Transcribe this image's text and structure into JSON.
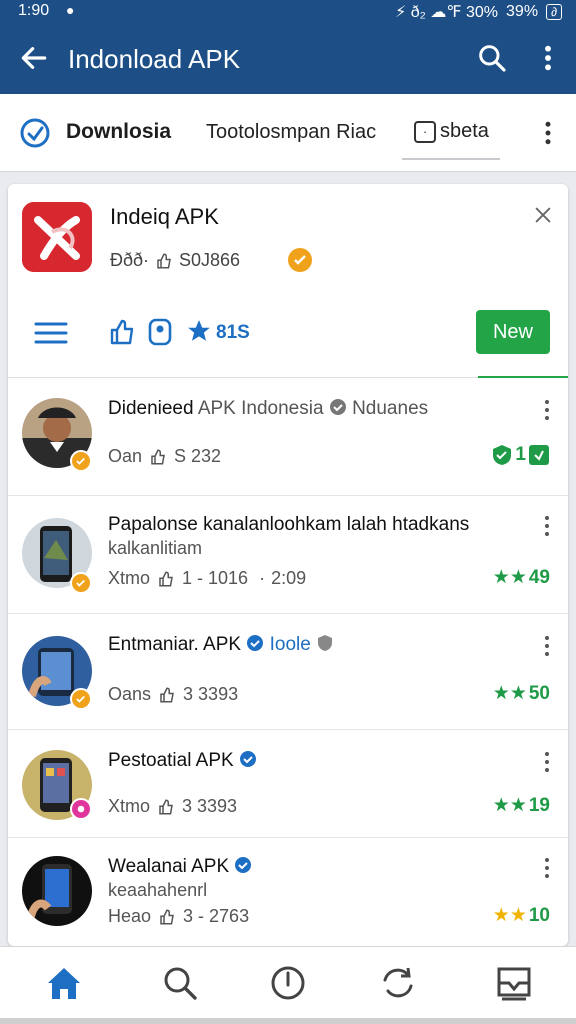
{
  "status_bar": {
    "time": "1:90",
    "indicators": "⚡ ð₂ ☁℉ 30%",
    "battery": "39%",
    "battery_box": "∂"
  },
  "app_bar": {
    "title": "Indonload APK",
    "icons": [
      "back-arrow-icon",
      "search-icon",
      "more-vertical-icon"
    ]
  },
  "tabs": [
    {
      "label": "Downlosia",
      "icon": "download-badge-icon"
    },
    {
      "label": "Tootolosmpan Riac"
    },
    {
      "label": "sbeta",
      "icon": "clock-box-icon"
    }
  ],
  "featured": {
    "title": "Indeiq APK",
    "meta_prefix": "Ððð·",
    "meta_count": "S0J866",
    "rating": "81S",
    "new_label": "New"
  },
  "list": [
    {
      "title": "Didenieed",
      "title_suffix": "APK Indonesia",
      "tag": "Nduanes",
      "meta_left": "Oan",
      "meta_right": "S 232",
      "rating": "1",
      "rating_color": "#1f9a46",
      "badge_color": "#f0a21a"
    },
    {
      "title": "Papalonse kanalanloohkam lalah htadkans",
      "line2": "kalkanlitiam",
      "meta_left": "Xtmo",
      "meta_right": "1 - 1016",
      "meta_extra": "2:09",
      "rating": "49",
      "rating_color": "#1f9a46",
      "badge_color": "#f0a21a"
    },
    {
      "title": "Entmaniar. APK",
      "tag": "Ioole",
      "meta_left": "Oans",
      "meta_right": "3 3393",
      "rating": "50",
      "rating_color": "#1f9a46",
      "badge_color": "#f0a21a"
    },
    {
      "title": "Pestoatial APK",
      "meta_left": "Xtmo",
      "meta_right": "3 3393",
      "rating": "19",
      "rating_color": "#1f9a46",
      "badge_color": "#e0359b"
    },
    {
      "title": "Wealanai APK",
      "line2": "keaahahenrl",
      "meta_left": "Heao",
      "meta_right": "3 - 2763",
      "rating": "10",
      "rating_color": "#1f9a46",
      "star_color": "#f0b400"
    }
  ],
  "bottom_nav": [
    "home-icon",
    "search-icon",
    "compass-icon",
    "refresh-icon",
    "inbox-icon"
  ],
  "colors": {
    "primary": "#1d4f86",
    "accent_green": "#22a447",
    "accent_blue": "#1d6fc4"
  }
}
